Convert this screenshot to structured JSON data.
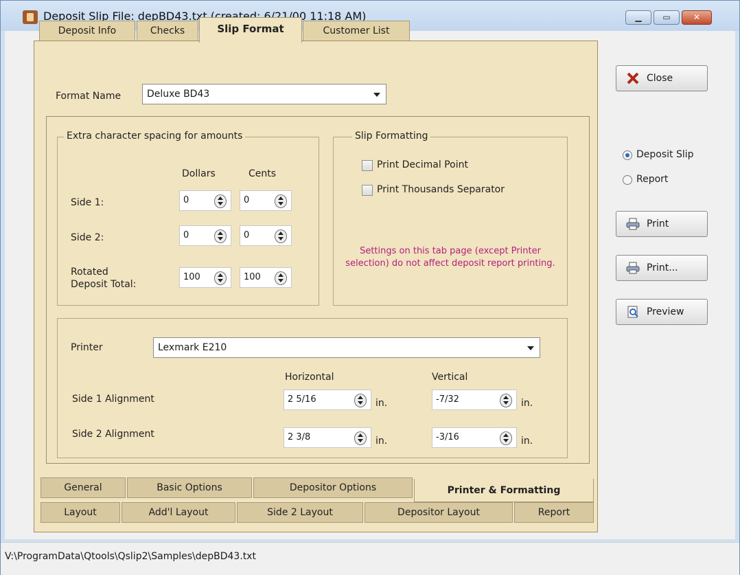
{
  "window": {
    "title": "Deposit Slip File:  depBD43.txt  (created: 6/21/00 11:18 AM)"
  },
  "top_tabs": [
    {
      "label": "Deposit Info"
    },
    {
      "label": "Checks"
    },
    {
      "label": "Slip Format"
    },
    {
      "label": "Customer List"
    }
  ],
  "format": {
    "label": "Format Name",
    "value": "Deluxe BD43"
  },
  "spacing": {
    "title": "Extra character spacing for amounts",
    "col_dollars": "Dollars",
    "col_cents": "Cents",
    "rows": [
      {
        "label": "Side 1:",
        "dollars": "0",
        "cents": "0"
      },
      {
        "label": "Side 2:",
        "dollars": "0",
        "cents": "0"
      },
      {
        "label": "Rotated\nDeposit Total:",
        "dollars": "100",
        "cents": "100"
      }
    ]
  },
  "slip_formatting": {
    "title": "Slip Formatting",
    "print_decimal_point": "Print Decimal Point",
    "print_thousands_separator": "Print Thousands Separator",
    "note": "Settings on this tab page (except Printer selection) do not affect deposit report printing."
  },
  "printer": {
    "label": "Printer",
    "value": "Lexmark E210",
    "horizontal": "Horizontal",
    "vertical": "Vertical",
    "side1": {
      "label": "Side 1 Alignment",
      "horizontal": "2 5/16",
      "vertical": "-7/32",
      "unit": "in."
    },
    "side2": {
      "label": "Side 2 Alignment",
      "horizontal": "2 3/8",
      "vertical": "-3/16",
      "unit": "in."
    }
  },
  "bottom_tabs_row1": [
    {
      "label": "General"
    },
    {
      "label": "Basic Options"
    },
    {
      "label": "Depositor Options"
    },
    {
      "label": "Printer & Formatting"
    }
  ],
  "bottom_tabs_row2": [
    {
      "label": "Layout"
    },
    {
      "label": "Add'l Layout"
    },
    {
      "label": "Side 2 Layout"
    },
    {
      "label": "Depositor Layout"
    },
    {
      "label": "Report"
    }
  ],
  "side": {
    "close": "Close",
    "radio_deposit_slip": "Deposit Slip",
    "radio_report": "Report",
    "print": "Print",
    "print_dialog": "Print...",
    "preview": "Preview"
  },
  "status": "V:\\ProgramData\\Qtools\\Qslip2\\Samples\\depBD43.txt"
}
